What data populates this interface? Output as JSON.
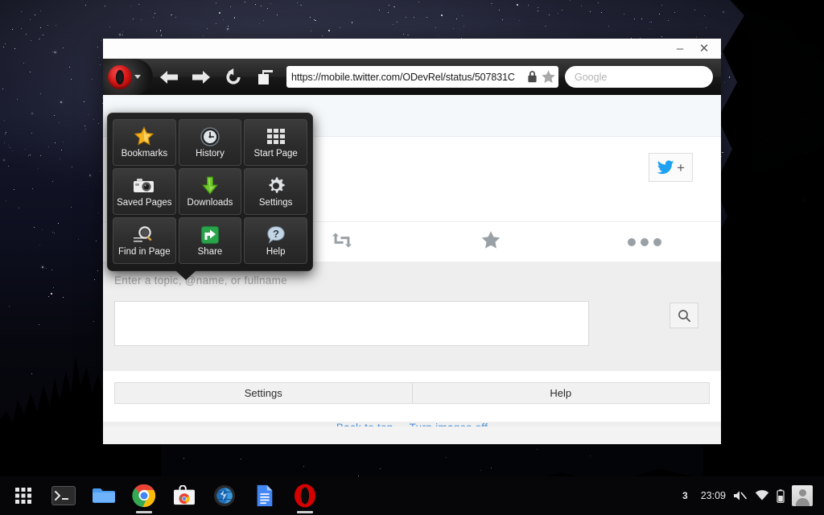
{
  "desktop": {
    "wallpaper_description": "starry night sky with pine tree silhouettes",
    "wallpaper_sky_color": "#12131f",
    "wallpaper_tree_color": "#000000"
  },
  "window": {
    "title": "",
    "controls": {
      "minimize": "–",
      "close": "✕"
    }
  },
  "toolbar": {
    "opera_menu_label": "O",
    "back_label": "Back",
    "forward_label": "Forward",
    "reload_label": "Reload",
    "tabs_label": "Tabs",
    "url": "https://mobile.twitter.com/ODevRel/status/507831C",
    "lock_icon": "lock-icon",
    "bookmark_icon": "star-icon",
    "search_placeholder": "Google"
  },
  "opera_menu": {
    "items": [
      {
        "label": "Bookmarks",
        "icon": "star-icon"
      },
      {
        "label": "History",
        "icon": "clock-icon"
      },
      {
        "label": "Start Page",
        "icon": "grid-icon"
      },
      {
        "label": "Saved Pages",
        "icon": "camera-icon"
      },
      {
        "label": "Downloads",
        "icon": "download-arrow-icon"
      },
      {
        "label": "Settings",
        "icon": "gear-icon"
      },
      {
        "label": "Find in Page",
        "icon": "magnifier-icon"
      },
      {
        "label": "Share",
        "icon": "share-icon"
      },
      {
        "label": "Help",
        "icon": "question-mark-icon"
      }
    ]
  },
  "page": {
    "site": "mobile.twitter.com",
    "follow_button": {
      "icon": "twitter-bird-icon",
      "plus": "+"
    },
    "tweet_actions": [
      {
        "name": "retweet",
        "icon": "retweet-icon"
      },
      {
        "name": "favorite",
        "icon": "star-icon"
      },
      {
        "name": "more",
        "icon": "ellipsis-icon"
      }
    ],
    "search": {
      "hint": "Enter a topic, @name, or fullname",
      "value": "",
      "placeholder": "",
      "submit_icon": "magnifier-icon"
    },
    "footer_buttons": [
      {
        "label": "Settings"
      },
      {
        "label": "Help"
      }
    ],
    "footer_links": {
      "back_to_top": "Back to top",
      "separator": "·",
      "turn_images_off": "Turn images off"
    },
    "accent_link_color": "#4a90d9",
    "twitter_blue": "#1da1f2"
  },
  "shelf": {
    "apps": [
      {
        "name": "app-launcher",
        "icon": "grid-icon"
      },
      {
        "name": "terminal",
        "icon": "terminal-icon"
      },
      {
        "name": "files",
        "icon": "folder-icon"
      },
      {
        "name": "chrome",
        "icon": "chrome-icon"
      },
      {
        "name": "web-store",
        "icon": "web-store-icon"
      },
      {
        "name": "browser",
        "icon": "globe-icon"
      },
      {
        "name": "docs",
        "icon": "document-icon"
      },
      {
        "name": "opera",
        "icon": "opera-icon"
      }
    ],
    "tray": {
      "count": "3",
      "clock": "23:09",
      "volume_icon": "volume-muted-icon",
      "wifi_icon": "wifi-icon",
      "battery_icon": "battery-icon",
      "avatar_icon": "user-avatar-icon"
    }
  }
}
